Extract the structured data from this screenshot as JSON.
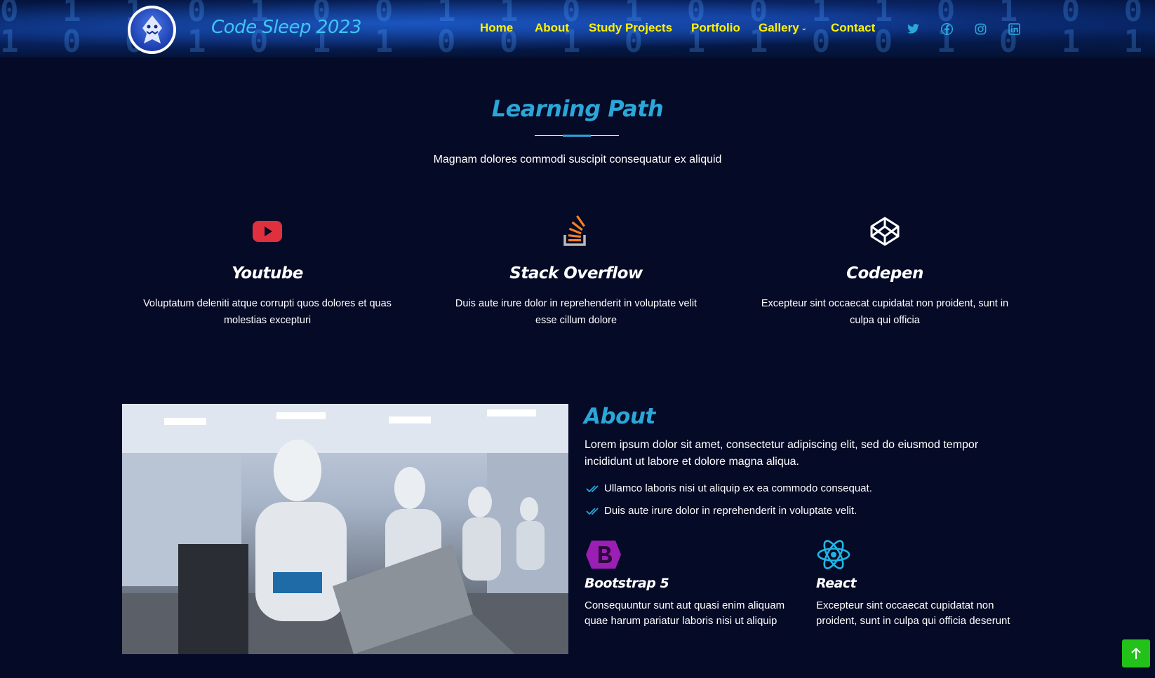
{
  "header": {
    "brand": "Code Sleep 2023",
    "nav": [
      {
        "label": "Home"
      },
      {
        "label": "About"
      },
      {
        "label": "Study Projects"
      },
      {
        "label": "Portfolio"
      },
      {
        "label": "Gallery",
        "has_dropdown": true
      },
      {
        "label": "Contact"
      }
    ],
    "socials": [
      "twitter-icon",
      "facebook-icon",
      "instagram-icon",
      "linkedin-icon"
    ]
  },
  "learning_path": {
    "title": "Learning Path",
    "subtitle": "Magnam dolores commodi suscipit consequatur ex aliquid",
    "cards": [
      {
        "icon": "youtube-icon",
        "title": "Youtube",
        "text": "Voluptatum deleniti atque corrupti quos dolores et quas molestias excepturi"
      },
      {
        "icon": "stack-overflow-icon",
        "title": "Stack Overflow",
        "text": "Duis aute irure dolor in reprehenderit in voluptate velit esse cillum dolore"
      },
      {
        "icon": "codepen-icon",
        "title": "Codepen",
        "text": "Excepteur sint occaecat cupidatat non proident, sunt in culpa qui officia"
      }
    ]
  },
  "about": {
    "title": "About",
    "lead": "Lorem ipsum dolor sit amet, consectetur adipiscing elit, sed do eiusmod tempor incididunt ut labore et dolore magna aliqua.",
    "checks": [
      "Ullamco laboris nisi ut aliquip ex ea commodo consequat.",
      "Duis aute irure dolor in reprehenderit in voluptate velit."
    ],
    "features": [
      {
        "icon": "bootstrap-icon",
        "title": "Bootstrap 5",
        "text": "Consequuntur sunt aut quasi enim aliquam quae harum pariatur laboris nisi ut aliquip"
      },
      {
        "icon": "react-icon",
        "title": "React",
        "text": "Excepteur sint occaecat cupidatat non proident, sunt in culpa qui officia deserunt"
      }
    ],
    "image": "robots-at-laptops-image"
  },
  "colors": {
    "background": "#050a26",
    "accent": "#2ba6d8",
    "nav_link": "#fff200",
    "brand": "#3ec6f2",
    "back_to_top": "#22c21a"
  },
  "back_to_top": "arrow-up-icon"
}
